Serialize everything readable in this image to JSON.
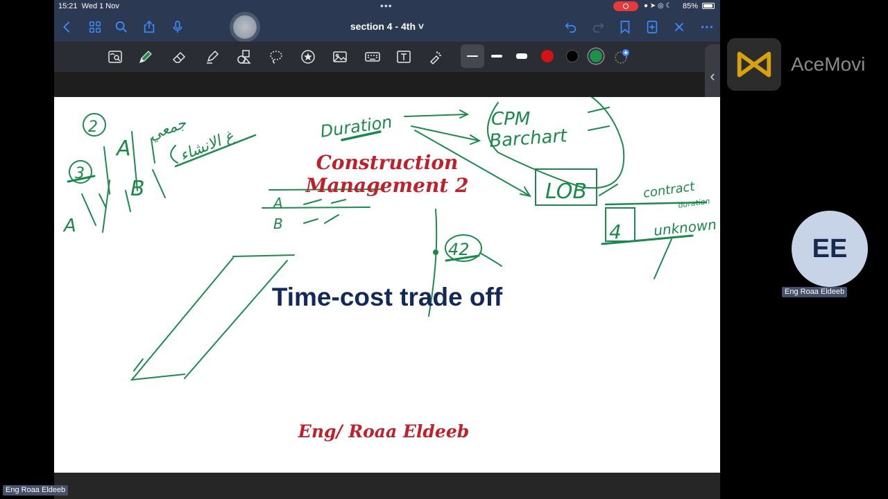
{
  "status_bar": {
    "time": "15:21",
    "date": "Wed 1 Nov",
    "battery": "85%"
  },
  "navbar": {
    "document_title": "section 4 - 4th ˅"
  },
  "slide": {
    "title": "Construction Management 2",
    "subtitle": "Time-cost trade off",
    "author": "Eng/ Roaa Eldeeb"
  },
  "handwriting": {
    "duration": "Duration",
    "cpm": "CPM",
    "barchart": "Barchart",
    "lob": "LOB",
    "contract": "contract",
    "duration_small": "duration",
    "unknown": "unknown",
    "box_label": "4",
    "circle_label": "42",
    "a_upper": "A",
    "b_upper": "B",
    "a_small": "A",
    "b_small": "B",
    "num_2": "2",
    "num_3": "3",
    "a_left": "A",
    "arabic_1": "جمعي",
    "arabic_2": "غ الانشاء"
  },
  "colors": {
    "ink_green": "#1a8a4a",
    "title_red": "#c0202a",
    "subtitle_navy": "#14285a",
    "accent_blue": "#3d8bff",
    "record_red": "#e5393b",
    "swatch_red": "#d21414",
    "swatch_black": "#000000",
    "swatch_green": "#1f8f4a"
  },
  "overlay": {
    "watermark": "AceMovi",
    "avatar_initials": "EE",
    "participant_name": "Eng Roaa Eldeeb",
    "bottom_name": "Eng Roaa Eldeeb"
  }
}
